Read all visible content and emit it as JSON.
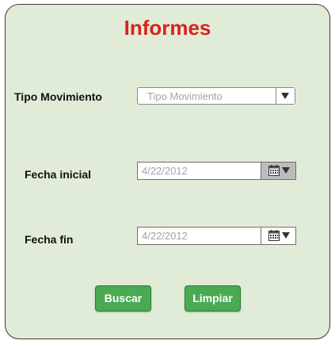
{
  "title": "Informes",
  "tipo_movimiento": {
    "label": "Tipo Movimiento",
    "placeholder": "Tipo Movimiento",
    "icon": "chevron-down-icon"
  },
  "fecha_inicial": {
    "label": "Fecha inicial",
    "placeholder": "4/22/2012",
    "icon": "calendar-icon"
  },
  "fecha_fin": {
    "label": "Fecha fin",
    "placeholder": "4/22/2012",
    "icon": "calendar-icon"
  },
  "buttons": {
    "search_label": "Buscar",
    "clear_label": "Limpiar"
  },
  "colors": {
    "panel_background": "#e1ecd8",
    "title": "#d9231c",
    "button": "#4aaa52"
  }
}
